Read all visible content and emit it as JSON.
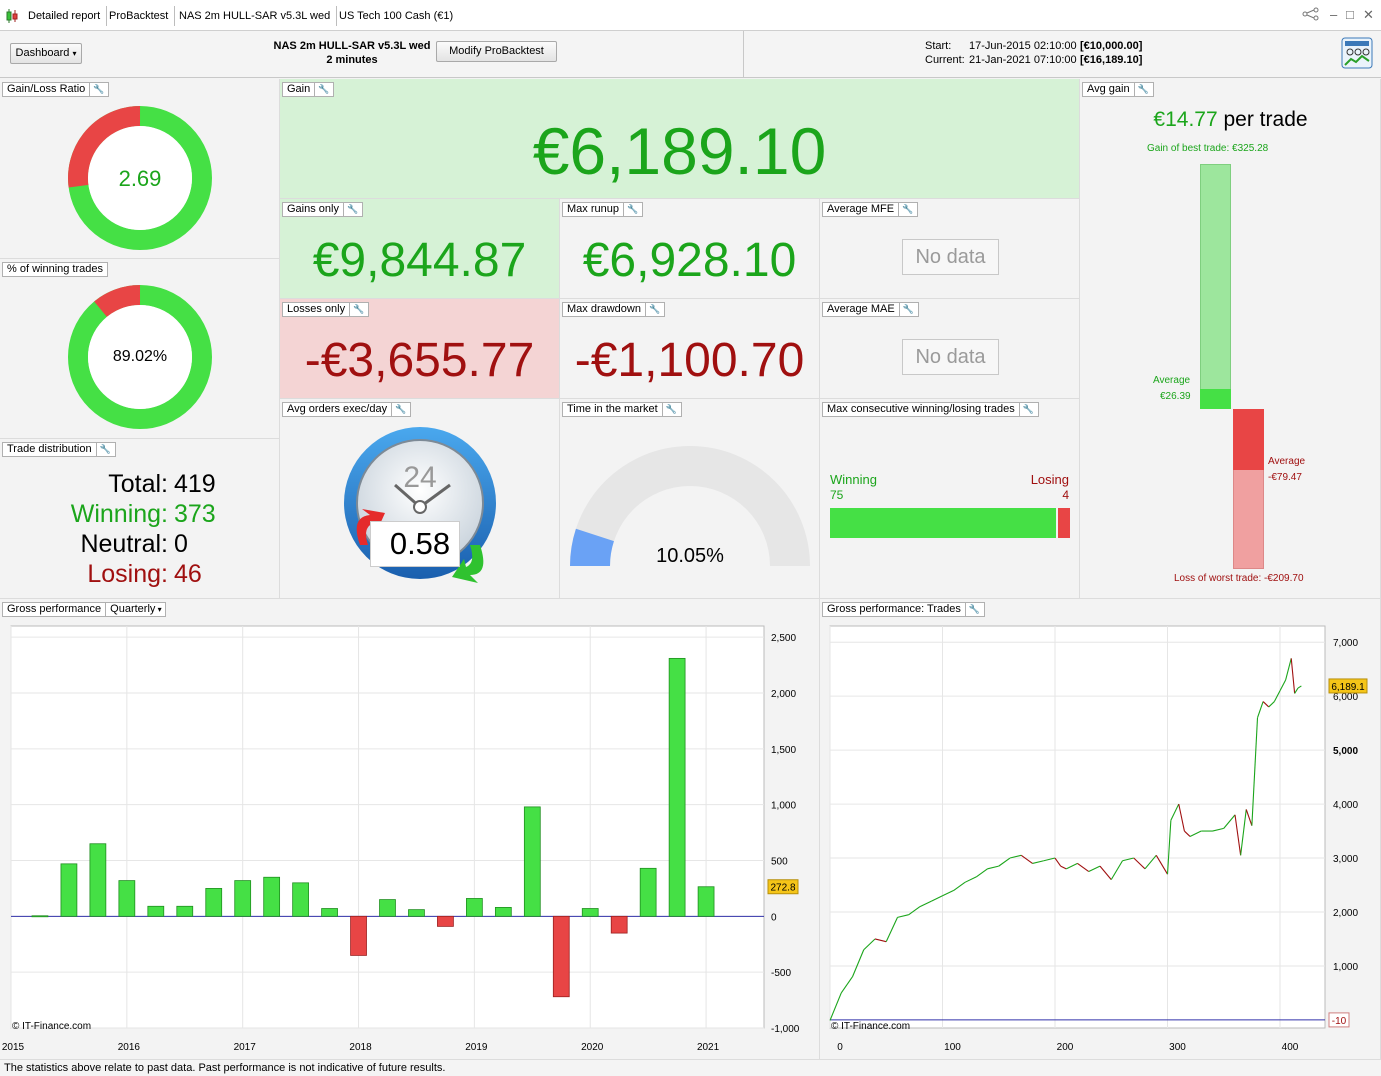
{
  "tabs": [
    "Detailed report",
    "ProBacktest",
    "NAS 2m HULL-SAR v5.3L wed",
    "US Tech 100 Cash (€1)"
  ],
  "toolbar": {
    "dashboard_label": "Dashboard",
    "strategy_name": "NAS 2m HULL-SAR v5.3L wed",
    "timeframe": "2 minutes",
    "modify_label": "Modify ProBacktest",
    "start_label": "Start:",
    "start_date": "17-Jun-2015 02:10:00",
    "start_value": "[€10,000.00]",
    "current_label": "Current:",
    "current_date": "21-Jan-2021 07:10:00",
    "current_value": "[€16,189.10]"
  },
  "panels": {
    "gain_loss_ratio": {
      "label": "Gain/Loss Ratio",
      "value": "2.69",
      "ratio": 2.69
    },
    "winning_pct": {
      "label": "% of winning trades",
      "value": "89.02%",
      "pct": 89.02
    },
    "trade_distribution": {
      "label": "Trade distribution",
      "total_label": "Total:",
      "total": "419",
      "winning_label": "Winning:",
      "winning": "373",
      "neutral_label": "Neutral:",
      "neutral": "0",
      "losing_label": "Losing:",
      "losing": "46"
    },
    "gain": {
      "label": "Gain",
      "value": "€6,189.10"
    },
    "gains_only": {
      "label": "Gains only",
      "value": "€9,844.87"
    },
    "losses_only": {
      "label": "Losses only",
      "value": "-€3,655.77"
    },
    "max_runup": {
      "label": "Max runup",
      "value": "€6,928.10"
    },
    "max_drawdown": {
      "label": "Max drawdown",
      "value": "-€1,100.70"
    },
    "average_mfe": {
      "label": "Average MFE",
      "value": "No data"
    },
    "average_mae": {
      "label": "Average MAE",
      "value": "No data"
    },
    "avg_orders": {
      "label": "Avg orders exec/day",
      "value": "0.58",
      "dial": "24"
    },
    "time_in_market": {
      "label": "Time in the market",
      "value": "10.05%",
      "pct": 10.05
    },
    "max_consecutive": {
      "label": "Max consecutive winning/losing trades",
      "winning_label": "Winning",
      "winning": "75",
      "losing_label": "Losing",
      "losing": "4"
    },
    "avg_gain": {
      "label": "Avg gain",
      "value": "€14.77",
      "suffix": "per trade",
      "best_trade": "Gain of best trade: €325.28",
      "avg_win_label": "Average",
      "avg_win": "€26.39",
      "avg_loss_label": "Average",
      "avg_loss": "-€79.47",
      "worst_trade": "Loss of worst trade: -€209.70",
      "best": 325.28,
      "avg_win_value": 26.39,
      "avg_loss_value": -79.47,
      "worst": -209.7
    }
  },
  "gross_perf": {
    "label": "Gross performance",
    "period_label": "Quarterly",
    "watermark": "© IT-Finance.com",
    "last_value_tag": "272.8"
  },
  "gross_trades": {
    "label": "Gross performance: Trades",
    "watermark": "© IT-Finance.com",
    "last_value_tag": "6,189.1",
    "zero_tag": "-10"
  },
  "chart_data": [
    {
      "type": "bar",
      "x_tick_labels": [
        "2015",
        "2016",
        "2017",
        "2018",
        "2019",
        "2020",
        "2021"
      ],
      "x_ticks": [
        2015,
        2016,
        2017,
        2018,
        2019,
        2020,
        2021
      ],
      "y_tick_labels": [
        "2,500",
        "2,000",
        "1,500",
        "1,000",
        "500",
        "0",
        "-500",
        "-1,000"
      ],
      "y_ticks": [
        2500,
        2000,
        1500,
        1000,
        500,
        0,
        -500,
        -1000
      ],
      "ylim": [
        -1000,
        2600
      ],
      "xlim": [
        2015.0,
        2021.5
      ],
      "x": [
        2015.25,
        2015.5,
        2015.75,
        2016.0,
        2016.25,
        2016.5,
        2016.75,
        2017.0,
        2017.25,
        2017.5,
        2017.75,
        2018.0,
        2018.25,
        2018.5,
        2018.75,
        2019.0,
        2019.25,
        2019.5,
        2019.75,
        2020.0,
        2020.25,
        2020.5,
        2020.75,
        2021.0
      ],
      "values": [
        5,
        470,
        650,
        320,
        90,
        90,
        250,
        320,
        350,
        300,
        70,
        -350,
        150,
        60,
        -90,
        160,
        80,
        980,
        -720,
        70,
        -150,
        430,
        2310,
        265
      ]
    },
    {
      "type": "line",
      "x_tick_labels": [
        "0",
        "100",
        "200",
        "300",
        "400"
      ],
      "x_ticks": [
        0,
        100,
        200,
        300,
        400
      ],
      "y_tick_labels": [
        "7,000",
        "6,000",
        "5,000",
        "4,000",
        "3,000",
        "2,000",
        "1,000"
      ],
      "y_ticks": [
        7000,
        6000,
        5000,
        4000,
        3000,
        2000,
        1000
      ],
      "ylim": [
        -150,
        7300
      ],
      "xlim": [
        0,
        440
      ],
      "x": [
        0,
        10,
        20,
        30,
        40,
        50,
        60,
        70,
        80,
        90,
        100,
        110,
        120,
        130,
        140,
        150,
        160,
        170,
        180,
        190,
        200,
        205,
        210,
        220,
        230,
        240,
        250,
        260,
        270,
        280,
        290,
        300,
        303,
        310,
        315,
        320,
        330,
        340,
        350,
        360,
        365,
        370,
        375,
        380,
        385,
        390,
        395,
        400,
        405,
        410,
        413,
        416,
        419
      ],
      "values": [
        -10,
        500,
        800,
        1300,
        1500,
        1450,
        1900,
        1950,
        2100,
        2200,
        2300,
        2400,
        2550,
        2650,
        2800,
        2850,
        3000,
        3050,
        2900,
        2950,
        3000,
        2850,
        2800,
        2900,
        2750,
        2850,
        2600,
        2950,
        3000,
        2800,
        3050,
        2700,
        3700,
        4000,
        3500,
        3400,
        3500,
        3500,
        3550,
        3800,
        3050,
        3900,
        3600,
        5600,
        5900,
        5800,
        5900,
        6100,
        6300,
        6700,
        6050,
        6150,
        6189
      ]
    }
  ]
}
